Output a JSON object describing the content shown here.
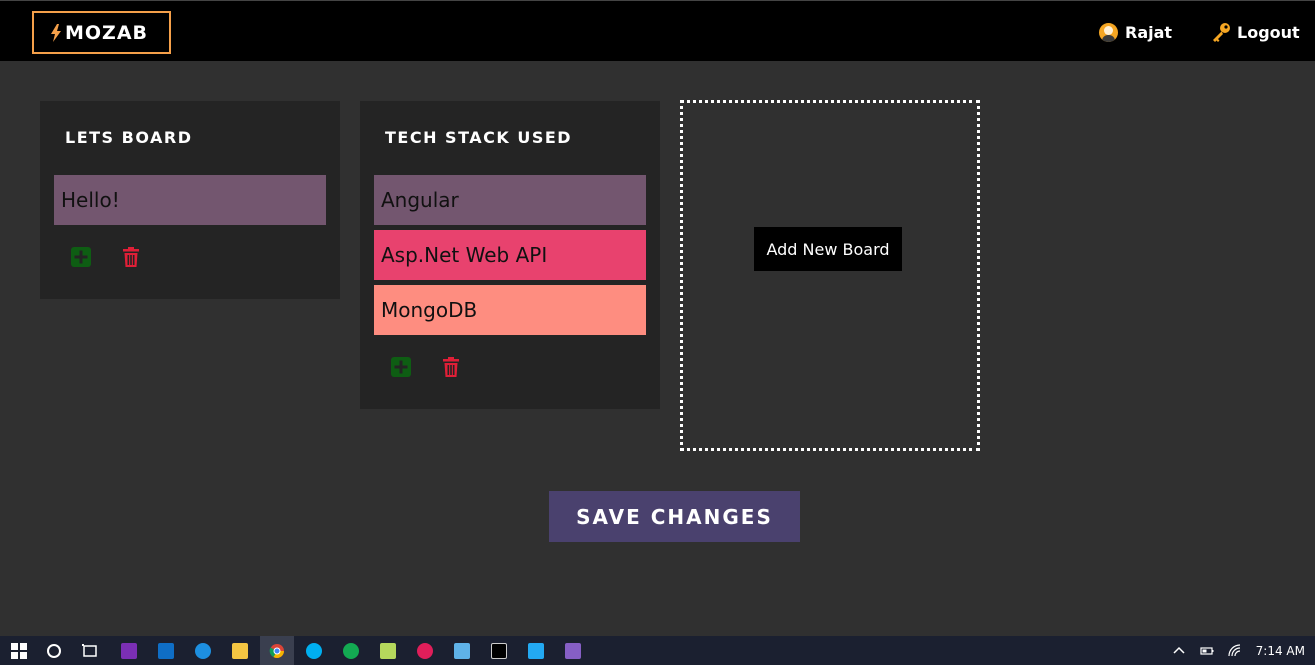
{
  "header": {
    "logo_text": "MOZAB",
    "user_name": "Rajat",
    "logout_label": "Logout"
  },
  "boards": [
    {
      "title": "LETS BOARD",
      "cards": [
        {
          "text": "Hello!",
          "color": "#73566f"
        }
      ]
    },
    {
      "title": "TECH STACK USED",
      "cards": [
        {
          "text": "Angular",
          "color": "#73566f"
        },
        {
          "text": "Asp.Net Web API",
          "color": "#e8426e"
        },
        {
          "text": "MongoDB",
          "color": "#fe8d80"
        }
      ]
    }
  ],
  "add_board_label": "Add New Board",
  "save_label": "SAVE CHANGES",
  "colors": {
    "accent": "#f5a04a",
    "add_icon": "#0e5d13",
    "delete_icon": "#e01f37",
    "save_button": "#4a416e"
  },
  "taskbar": {
    "apps": [
      "windows-start-icon",
      "cortana-icon",
      "task-view-icon",
      "onenote-icon",
      "outlook-icon",
      "edge-icon",
      "file-explorer-icon",
      "chrome-icon",
      "skype-icon",
      "mongodb-icon",
      "notepad-icon",
      "slack-icon",
      "paint-icon",
      "cmd-icon",
      "vscode-icon",
      "visual-studio-icon"
    ],
    "time": "7:14 AM"
  }
}
